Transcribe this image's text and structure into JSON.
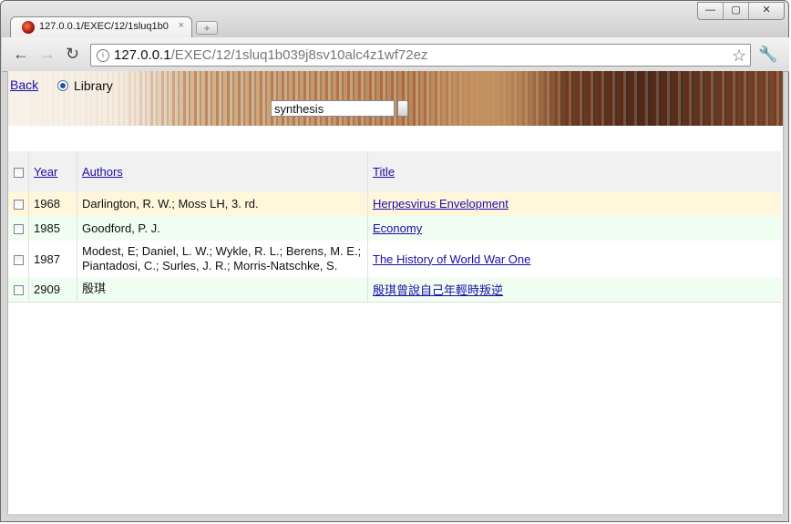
{
  "browser": {
    "tab_title": "127.0.0.1/EXEC/12/1sluq1b0",
    "tab_close": "×",
    "new_tab": "+",
    "window_controls": [
      "—",
      "▢",
      "✕"
    ],
    "nav": {
      "back": "←",
      "forward": "→",
      "reload": "↻"
    },
    "url_host": "127.0.0.1",
    "url_path": "/EXEC/12/1sluq1b039j8sv10alc4z1wf72ez",
    "star": "☆",
    "menu": "🔧"
  },
  "header": {
    "back_label": "Back",
    "library_label": "Library",
    "search_value": "synthesis"
  },
  "table": {
    "columns": {
      "year": "Year",
      "authors": "Authors",
      "title": "Title"
    },
    "rows": [
      {
        "year": "1968",
        "authors": "Darlington, R. W.; Moss LH, 3. rd.",
        "title": "Herpesvirus Envelopment"
      },
      {
        "year": "1985",
        "authors": "Goodford, P. J.",
        "title": "Economy"
      },
      {
        "year": "1987",
        "authors": "Modest, E; Daniel, L. W.; Wykle, R. L.; Berens, M. E.; Piantadosi, C.; Surles, J. R.; Morris-Natschke, S.",
        "title": "The History of World War One"
      },
      {
        "year": "2909",
        "authors": "殷琪",
        "title": "殷琪曾說自己年輕時叛逆"
      }
    ]
  }
}
